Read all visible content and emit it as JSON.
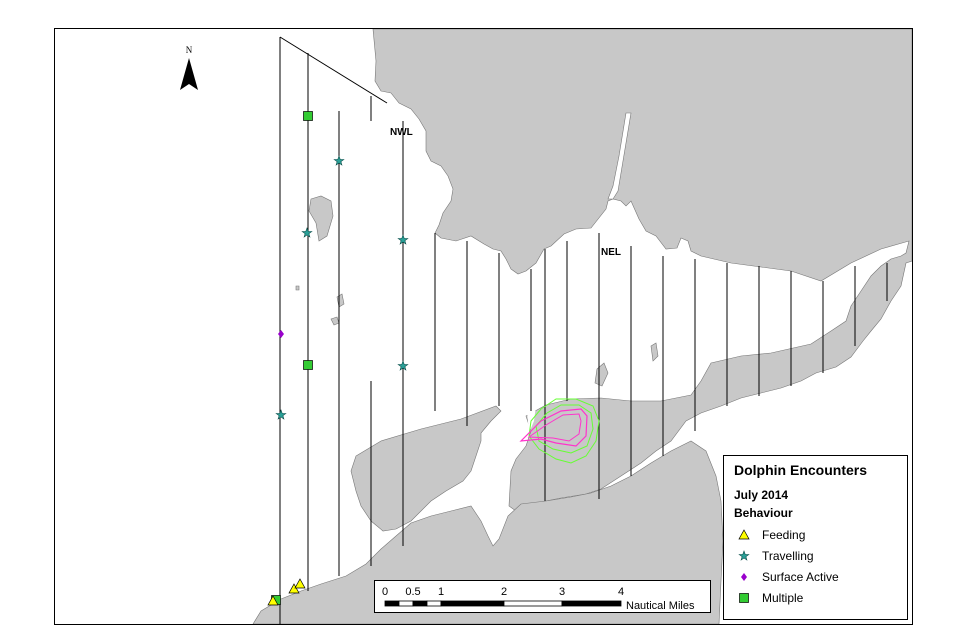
{
  "map": {
    "labels": {
      "nwl": "NWL",
      "nel": "NEL"
    },
    "north_label": "N",
    "colors": {
      "land": "#c8c8c8",
      "transect": "#000000",
      "contour_green": "#66ff33",
      "contour_magenta": "#ff33cc",
      "feeding": "#ffff00",
      "travelling": "#2aa198",
      "surface_active": "#9900cc",
      "multiple": "#33cc33"
    }
  },
  "legend": {
    "title": "Dolphin Encounters",
    "period": "July 2014",
    "group": "Behaviour",
    "items": [
      {
        "label": "Feeding",
        "icon": "triangle-icon"
      },
      {
        "label": "Travelling",
        "icon": "star-icon"
      },
      {
        "label": "Surface Active",
        "icon": "diamond-icon"
      },
      {
        "label": "Multiple",
        "icon": "square-icon"
      }
    ]
  },
  "scale": {
    "ticks": [
      "0",
      "0.5",
      "1",
      "2",
      "3",
      "4"
    ],
    "unit": "Nautical Miles"
  }
}
